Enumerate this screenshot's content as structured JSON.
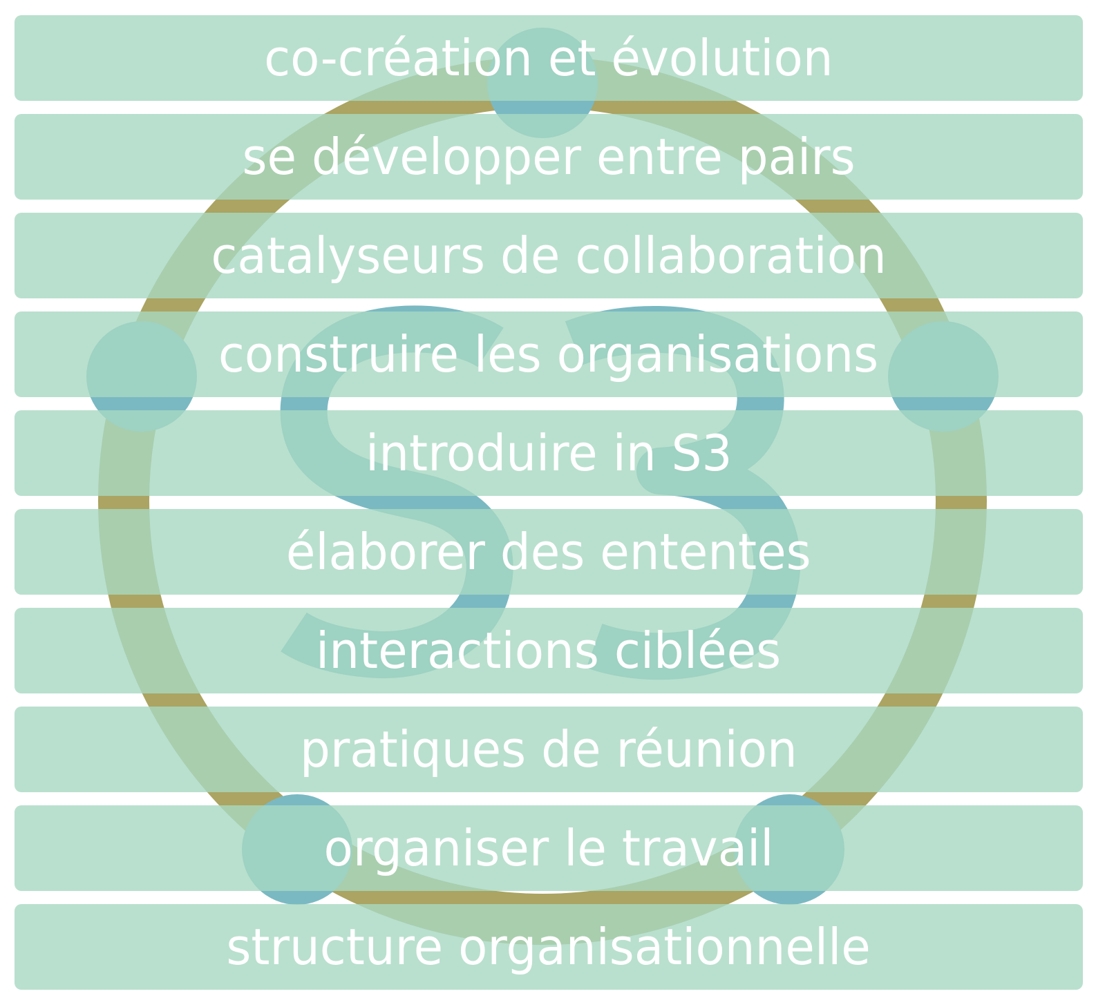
{
  "diagram": {
    "logo": {
      "name": "S3",
      "ring_color": "#aba462",
      "node_color": "#7ab9c2",
      "letters_color": "#7ab9c2"
    },
    "band_color": "#a8d8c2",
    "text_color": "#ffffff",
    "layers": [
      {
        "label": "co-création et évolution"
      },
      {
        "label": "se développer entre pairs"
      },
      {
        "label": "catalyseurs de collaboration"
      },
      {
        "label": "construire les organisations"
      },
      {
        "label": "introduire in S3"
      },
      {
        "label": "élaborer des ententes"
      },
      {
        "label": "interactions ciblées"
      },
      {
        "label": "pratiques de réunion"
      },
      {
        "label": "organiser le travail"
      },
      {
        "label": "structure organisationnelle"
      }
    ]
  }
}
